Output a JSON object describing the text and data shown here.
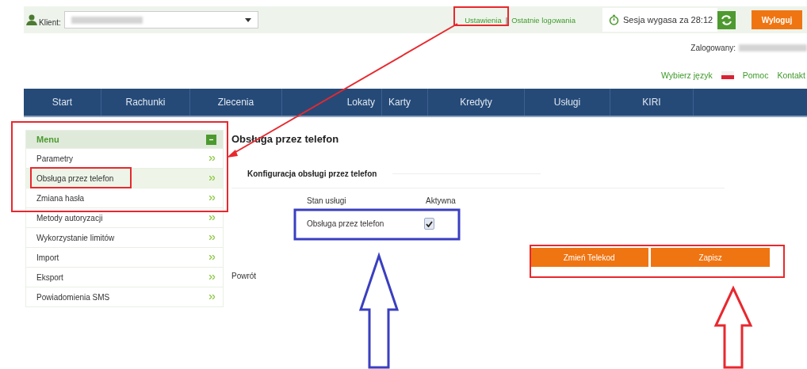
{
  "top_bar": {
    "client_label": "Klient:",
    "links": [
      {
        "label": "Ustawienia"
      },
      {
        "label": "Ostatnie logowania"
      }
    ],
    "separator": "|",
    "session": "Sesja wygasa za 28:12",
    "logout": "Wyloguj"
  },
  "user_row": {
    "label": "Zalogowany:"
  },
  "utility_links": {
    "language": "Wybierz język",
    "help": "Pomoc",
    "contact": "Kontakt"
  },
  "nav": [
    {
      "label": "Start"
    },
    {
      "label": "Rachunki"
    },
    {
      "label": "Zlecenia"
    },
    {
      "label": "Lokaty"
    },
    {
      "label": "Karty"
    },
    {
      "label": "Kredyty"
    },
    {
      "label": "Usługi"
    },
    {
      "label": "KIRI"
    }
  ],
  "sidebar": {
    "title": "Menu",
    "expanded": true,
    "items": [
      {
        "label": "Parametry",
        "selected": false
      },
      {
        "label": "Obsługa przez telefon",
        "selected": true
      },
      {
        "label": "Zmiana hasła",
        "selected": false
      },
      {
        "label": "Metody autoryzacji",
        "selected": false
      },
      {
        "label": "Wykorzystanie limitów",
        "selected": false
      },
      {
        "label": "Import",
        "selected": false
      },
      {
        "label": "Eksport",
        "selected": false
      },
      {
        "label": "Powiadomienia SMS",
        "selected": false
      }
    ]
  },
  "main": {
    "title": "Obsługa przez telefon",
    "section": "Konfiguracja obsługi przez telefon",
    "columns": [
      "Stan usługi",
      "Aktywna"
    ],
    "rows": [
      {
        "name": "Obsługa przez telefon",
        "checked": true
      }
    ],
    "back": "Powrót",
    "buttons": [
      "Zmień Telekod",
      "Zapisz"
    ]
  }
}
